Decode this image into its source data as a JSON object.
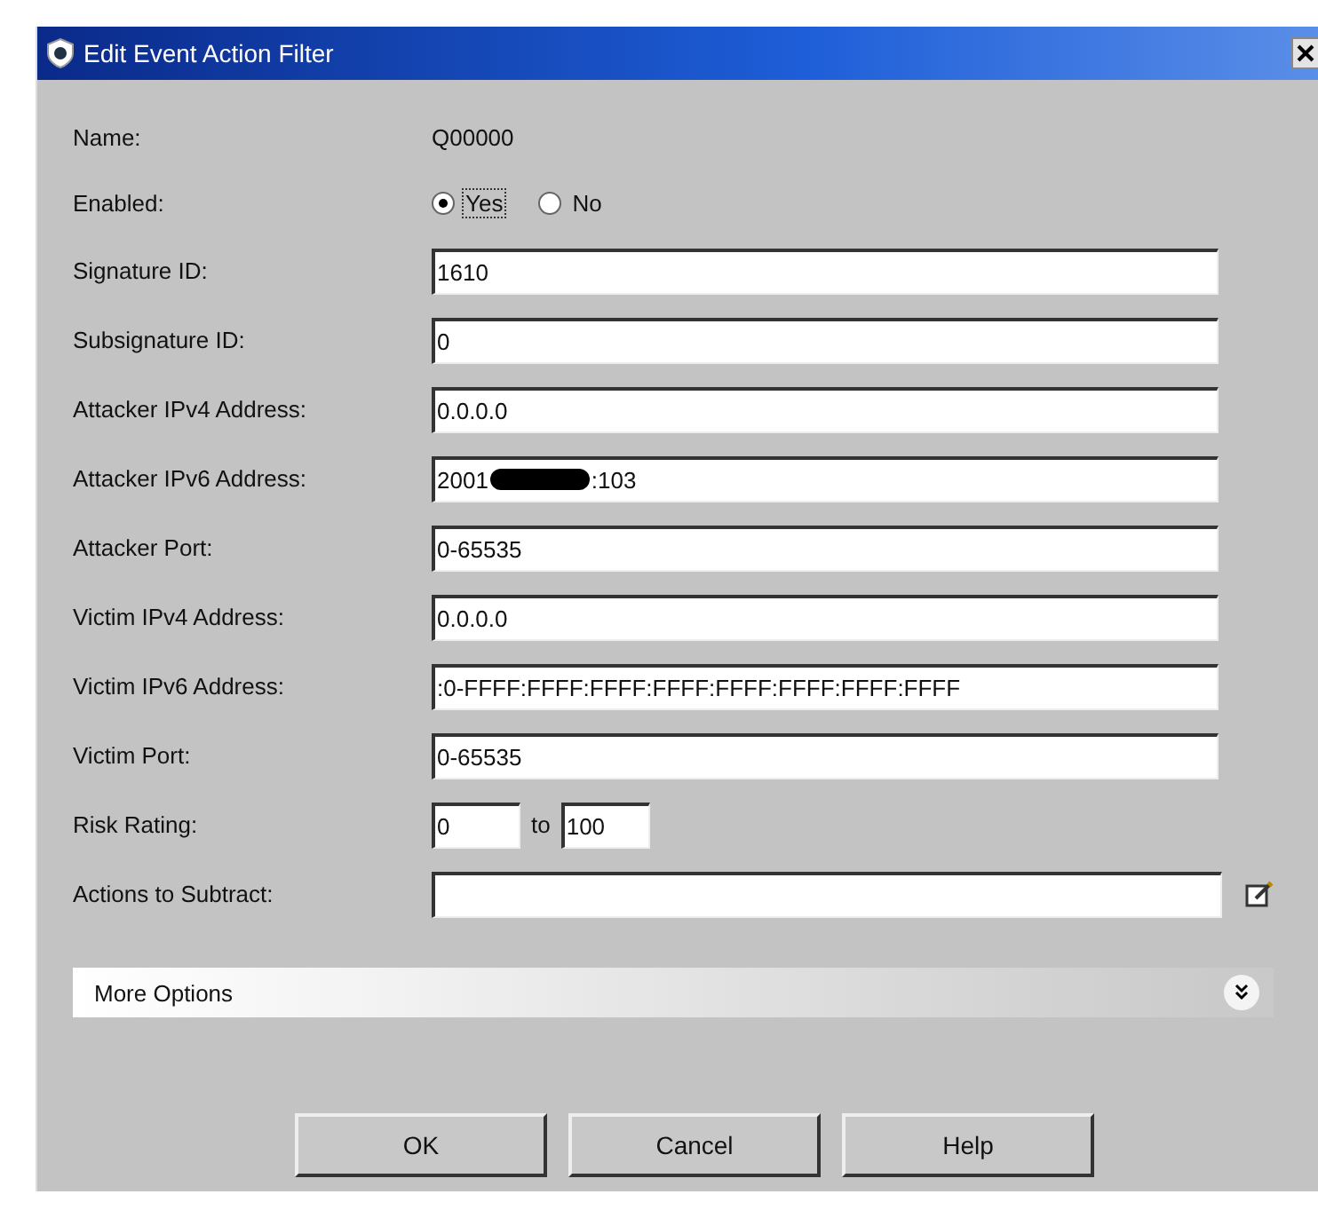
{
  "window": {
    "title": "Edit Event Action Filter"
  },
  "name": {
    "label": "Name:",
    "value": "Q00000"
  },
  "enabled": {
    "label": "Enabled:",
    "options": [
      {
        "label": "Yes",
        "selected": true
      },
      {
        "label": "No",
        "selected": false
      }
    ]
  },
  "fields": [
    {
      "label": "Signature ID:",
      "value": "1610"
    },
    {
      "label": "Subsignature ID:",
      "value": "0"
    },
    {
      "label": "Attacker IPv4 Address:",
      "value": "0.0.0.0"
    },
    {
      "label": "Attacker IPv6 Address:",
      "value": "2001",
      "value_after_redaction": ":103",
      "redacted": true
    },
    {
      "label": "Attacker Port:",
      "value": "0-65535"
    },
    {
      "label": "Victim IPv4 Address:",
      "value": "0.0.0.0"
    },
    {
      "label": "Victim IPv6 Address:",
      "value": ":0-FFFF:FFFF:FFFF:FFFF:FFFF:FFFF:FFFF:FFFF"
    },
    {
      "label": "Victim Port:",
      "value": "0-65535"
    }
  ],
  "risk_rating": {
    "label": "Risk Rating:",
    "from": "0",
    "separator": "to",
    "to": "100"
  },
  "actions_to_subtract": {
    "label": "Actions to Subtract:"
  },
  "more_options": {
    "label": "More Options",
    "expanded": false
  },
  "buttons": [
    "OK",
    "Cancel",
    "Help"
  ]
}
